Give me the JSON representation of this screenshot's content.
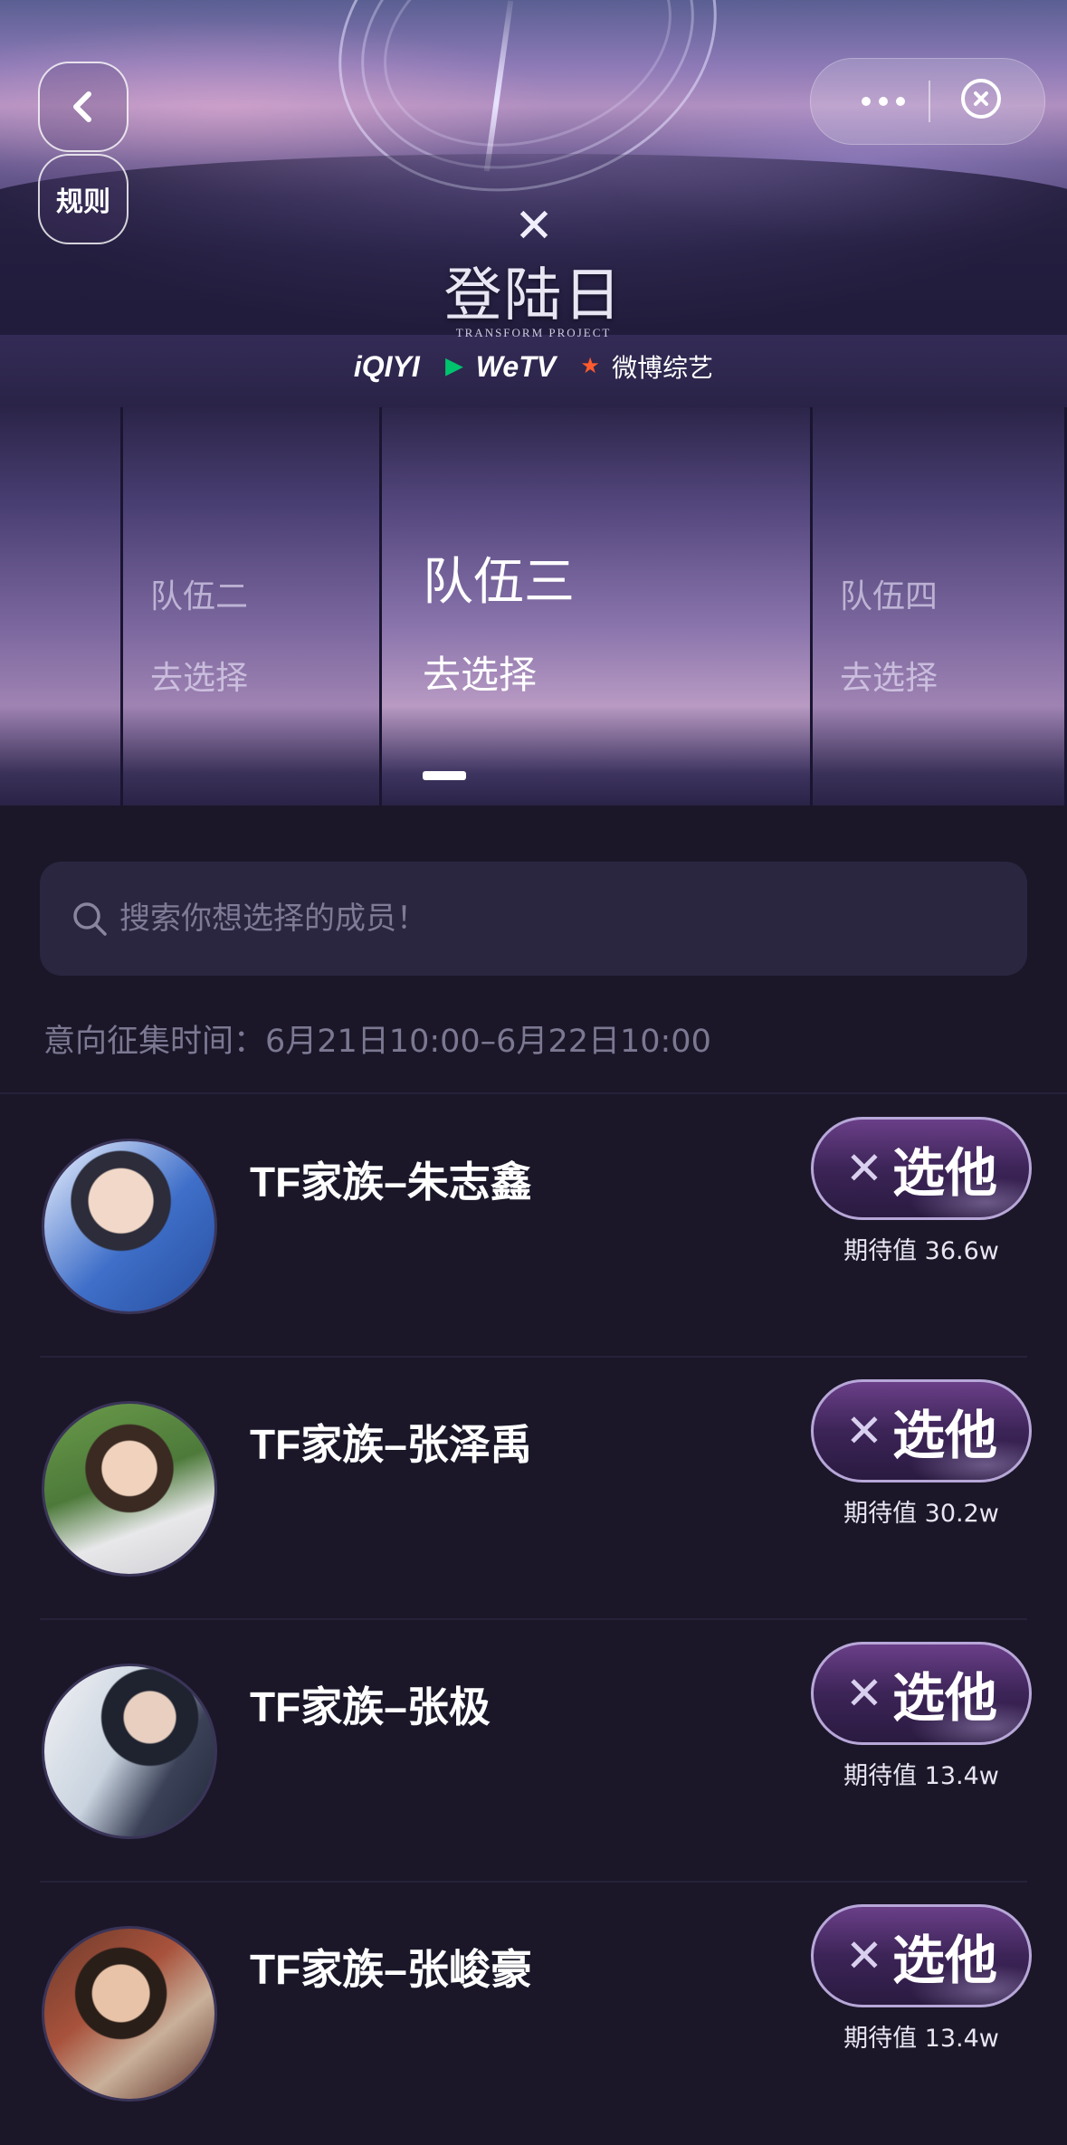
{
  "header": {
    "rules_label": "规则",
    "show_title": "登陆日",
    "show_subtitle": "TRANSFORM PROJECT",
    "partners": [
      "iQIYI",
      "WeTV",
      "微博综艺"
    ]
  },
  "teams": {
    "left_partial": {
      "name": "",
      "action": ""
    },
    "prev": {
      "name": "队伍二",
      "action": "去选择"
    },
    "active": {
      "name": "队伍三",
      "action": "去选择"
    },
    "next": {
      "name": "队伍四",
      "action": "去选择"
    }
  },
  "search": {
    "placeholder": "搜索你想选择的成员！"
  },
  "collect_time": "意向征集时间：6月21日10:00–6月22日10:00",
  "members": [
    {
      "name": "TF家族–朱志鑫",
      "button_label": "选他",
      "expect": "期待值 36.6w",
      "avatar_color": "#3f6fc9"
    },
    {
      "name": "TF家族–张泽禹",
      "button_label": "选他",
      "expect": "期待值 30.2w",
      "avatar_color": "#4d7a3a"
    },
    {
      "name": "TF家族–张极",
      "button_label": "选他",
      "expect": "期待值 13.4w",
      "avatar_color": "#b9c7d9"
    },
    {
      "name": "TF家族–张峻豪",
      "button_label": "选他",
      "expect": "期待值 13.4w",
      "avatar_color": "#8c3a2c"
    }
  ],
  "colors": {
    "background": "#1b1729",
    "accent_button": "#3c2457"
  },
  "icons": [
    "back-icon",
    "more-icon",
    "close-icon",
    "search-icon",
    "x-logo-icon"
  ]
}
